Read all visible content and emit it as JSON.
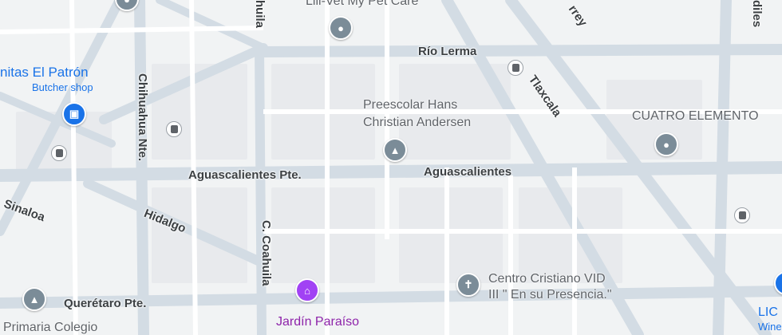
{
  "map": {
    "colors": {
      "background": "#f1f3f4",
      "road": "#ffffff",
      "major_road": "#d3dce4",
      "poi_gray": "#7b8c98",
      "poi_blue": "#1a73e8",
      "poi_purple": "#a142f4"
    },
    "streets": {
      "rio_lerma": "Río Lerma",
      "tlaxcala": "Tlaxcala",
      "aguascalientes_pte": "Aguascalientes Pte.",
      "aguascalientes": "Aguascalientes",
      "chihuahua_nte": "Chihuahua Nte.",
      "sinaloa": "Sinaloa",
      "hidalgo": "Hidalgo",
      "coahuila": "C. Coahuila",
      "queretaro_pte": "Querétaro Pte.",
      "coahuila_top": "huila",
      "monterrey": "rrey",
      "jardines": "diles"
    },
    "places": {
      "vet": "Lili-Vet My Pet Care",
      "butcher_name": "nitas El Patrón",
      "butcher_type": "Butcher shop",
      "preescolar_line1": "Preescolar Hans",
      "preescolar_line2": "Christian Andersen",
      "cuatro": "CUATRO ELEMENTO",
      "centro_line1": "Centro Cristiano VID",
      "centro_line2": "III \" En su Presencia.\"",
      "jardin": "Jardín Paraíso",
      "primaria": "Primaria Colegio",
      "lic": "LIC",
      "wine": "Wine"
    },
    "icons": {
      "vet": "pin-icon",
      "butcher": "shopping-bag-icon",
      "preescolar": "school-icon",
      "cuatro": "pin-icon",
      "centro": "cross-icon",
      "jardin": "building-icon",
      "primaria": "school-icon",
      "bus": "bus-icon"
    }
  }
}
